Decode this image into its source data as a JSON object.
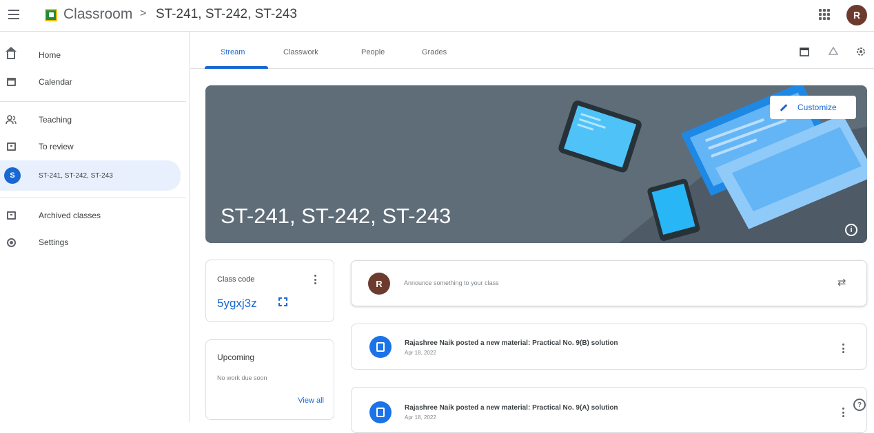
{
  "header": {
    "app_title": "Classroom",
    "separator": ">",
    "breadcrumb": "ST-241, ST-242, ST-243",
    "avatar_initial": "R"
  },
  "sidebar": {
    "items": [
      {
        "label": "Home",
        "icon": "home-icon"
      },
      {
        "label": "Calendar",
        "icon": "calendar-icon"
      },
      {
        "label": "Teaching",
        "icon": "people-icon"
      },
      {
        "label": "To review",
        "icon": "folder-icon"
      },
      {
        "label": "ST-241, ST-242, ST-243",
        "icon": "class-avatar",
        "initial": "S",
        "active": true
      },
      {
        "label": "Archived classes",
        "icon": "archive-icon"
      },
      {
        "label": "Settings",
        "icon": "settings-icon"
      }
    ]
  },
  "tabs": [
    {
      "label": "Stream",
      "active": true
    },
    {
      "label": "Classwork"
    },
    {
      "label": "People"
    },
    {
      "label": "Grades"
    }
  ],
  "banner": {
    "title": "ST-241, ST-242, ST-243",
    "customize_label": "Customize",
    "info_glyph": "i",
    "color": "#5f6d79"
  },
  "class_code": {
    "label": "Class code",
    "value": "5ygxj3z"
  },
  "upcoming": {
    "title": "Upcoming",
    "note": "No work due soon",
    "link": "View all"
  },
  "announce": {
    "avatar_initial": "R",
    "placeholder": "Announce something to your class"
  },
  "posts": [
    {
      "title": "Rajashree Naik posted a new material: Practical No. 9(B) solution",
      "date": "Apr 18, 2022"
    },
    {
      "title": "Rajashree Naik posted a new material: Practical No. 9(A) solution",
      "date": "Apr 18, 2022"
    }
  ],
  "help_glyph": "?",
  "colors": {
    "accent": "#1967d2",
    "active_nav_bg": "#e8f0fe",
    "avatar": "#6d3b2e"
  }
}
